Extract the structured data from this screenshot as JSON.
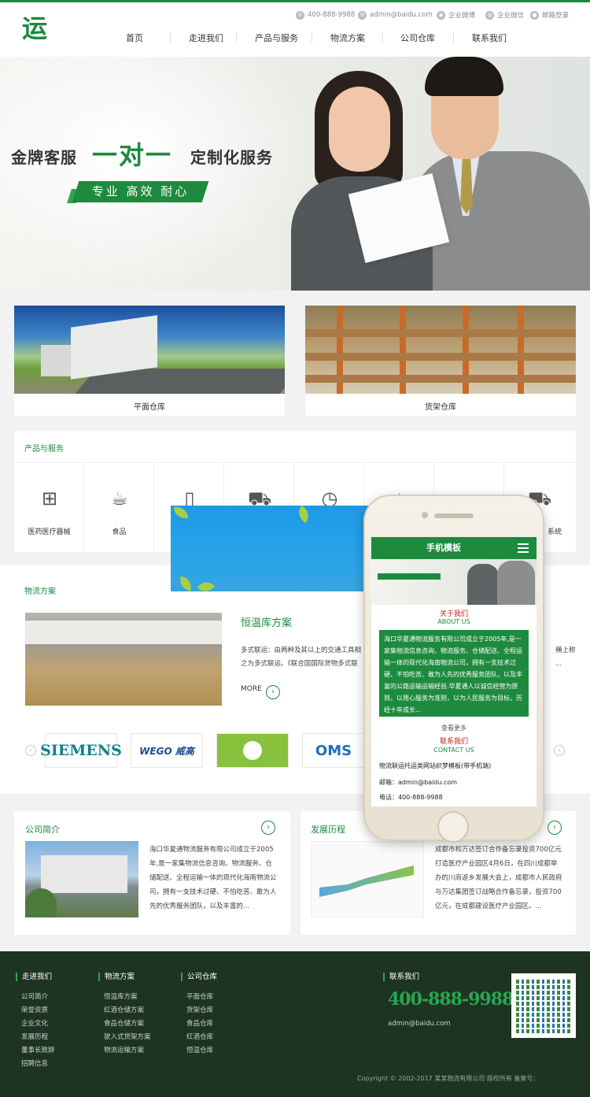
{
  "colors": {
    "brand": "#1d8a3e",
    "footer_bg": "#1e3423",
    "popup_blue": "#1e9ae6"
  },
  "header": {
    "logo": "运",
    "phone": "400-888-9988",
    "email": "admin@baidu.com",
    "weibo": "企业微博",
    "weixin": "企业微信",
    "mail_login": "邮箱登录",
    "nav": [
      "首页",
      "走进我们",
      "产品与服务",
      "物流方案",
      "公司仓库",
      "联系我们"
    ]
  },
  "banner": {
    "t1": "金牌客服",
    "t2": "一对一",
    "t3": "定制化服务",
    "tag": "专业 高效 耐心"
  },
  "warehouses": [
    "平面仓库",
    "货架仓库"
  ],
  "products": {
    "title": "产品与服务",
    "items": [
      {
        "label": "医药医疗器械",
        "icon": "medical-kit-icon"
      },
      {
        "label": "食品",
        "icon": "food-icon"
      },
      {
        "label": "",
        "icon": "drink-icon"
      },
      {
        "label": "",
        "icon": "forklift-icon"
      },
      {
        "label": "",
        "icon": "clock-truck-icon"
      },
      {
        "label": "",
        "icon": "warehouse-icon"
      },
      {
        "label": "",
        "icon": "card-icon"
      },
      {
        "label": "系统",
        "icon": "delivery-icon"
      }
    ]
  },
  "logistics": {
    "title": "物流方案",
    "case_title": "恒温库方案",
    "text": "多式联运：由两种及其以上的交通工具相之为多式联运。《联合国国际货物多式联",
    "text_tail": "横上称 ...",
    "more": "MORE",
    "brands": [
      "SIEMENS",
      "WEGO 威高",
      "",
      "OMS"
    ]
  },
  "about": {
    "title": "公司简介",
    "text": "海口华夏通物流服务有限公司成立于2005年,是一家集物流信息咨询、物流服务、仓储配送、全程运输一体的现代化海南物流公司，拥有一支技术过硬、不怕吃苦、敢为人先的优秀服务团队，以及丰富的..."
  },
  "history": {
    "title": "发展历程",
    "text": "成都市和万达签订合作备忘录投资700亿元打造医疗产业园区4月6日，在四川成都举办的川商返乡发展大会上，成都市人民政府与万达集团签订战略合作备忘录，投资700亿元，在成都建设医疗产业园区。..."
  },
  "footer": {
    "cols": [
      {
        "head": "走进我们",
        "links": [
          "公司简介",
          "荣誉资质",
          "企业文化",
          "发展历程",
          "董事长致辞",
          "招聘信息"
        ]
      },
      {
        "head": "物流方案",
        "links": [
          "恒温库方案",
          "红酒仓储方案",
          "食品仓储方案",
          "驶入式货架方案",
          "物流运输方案"
        ]
      },
      {
        "head": "公司仓库",
        "links": [
          "平面仓库",
          "货架仓库",
          "食品仓库",
          "红酒仓库",
          "恒温仓库"
        ]
      }
    ],
    "contact_head": "联系我们",
    "phone": "400-888-9988",
    "email": "admin@baidu.com",
    "copyright": "Copyright © 2002-2017 某某物流有限公司 版权所有 备案号："
  },
  "phone_mock": {
    "title": "手机模板",
    "about_h": "关于我们",
    "about_en": "ABOUT US",
    "about_text": "海口华夏通物流服务有限公司成立于2005年,是一家集物流信息咨询、物流服务、仓储配送、全程运输一体的现代化海南物流公司，拥有一支技术过硬、不怕吃苦、敢为人先的优秀服务团队，以及丰富的公路运输运输经验.华夏通人以诚信经营为原则，以用心服务为准则，以为人民服务为目标，历经十年成长...",
    "more": "查看更多",
    "contact_h": "联系我们",
    "contact_en": "CONTACT US",
    "company": "物流联运托运类网站织梦模板(带手机端)",
    "email": "邮箱：admin@baidu.com",
    "tel": "电话：400-888-9988"
  }
}
